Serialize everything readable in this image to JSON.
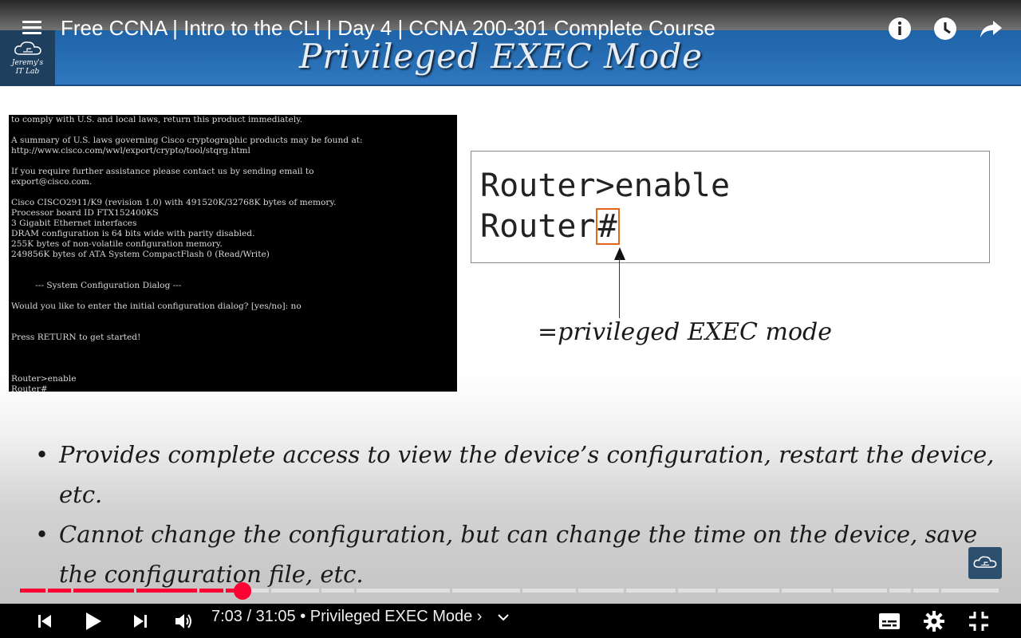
{
  "video": {
    "title": "Free CCNA | Intro to the CLI | Day 4 | CCNA 200-301 Complete Course",
    "current_time": "7:03",
    "duration": "31:05",
    "chapter": "Privileged EXEC Mode",
    "progress_fraction": 0.227
  },
  "top_icons": [
    "info-icon",
    "watch-later-icon",
    "share-icon"
  ],
  "slide": {
    "logo_text": [
      "Jeremy's",
      "IT Lab"
    ],
    "title": "Privileged EXEC Mode",
    "terminal_lines": [
      "to comply with U.S. and local laws, return this product immediately.",
      "",
      "A summary of U.S. laws governing Cisco cryptographic products may be found at:",
      "http://www.cisco.com/wwl/export/crypto/tool/stqrg.html",
      "",
      "If you require further assistance please contact us by sending email to",
      "export@cisco.com.",
      "",
      "Cisco CISCO2911/K9 (revision 1.0) with 491520K/32768K bytes of memory.",
      "Processor board ID FTX152400KS",
      "3 Gigabit Ethernet interfaces",
      "DRAM configuration is 64 bits wide with parity disabled.",
      "255K bytes of non-volatile configuration memory.",
      "249856K bytes of ATA System CompactFlash 0 (Read/Write)",
      "",
      "",
      "         --- System Configuration Dialog ---",
      "",
      "Would you like to enter the initial configuration dialog? [yes/no]: no",
      "",
      "",
      "Press RETURN to get started!",
      "",
      "",
      "",
      "Router>enable",
      "Router#"
    ],
    "router_line1": "Router>enable",
    "router_prompt": "Router",
    "router_hash": "#",
    "annotation": "=privileged EXEC mode",
    "bullets": [
      "Provides complete access to view the device’s configuration, restart the device, etc.",
      "Cannot change the configuration, but can change the time on the device, save the configuration file, etc."
    ]
  },
  "controls": {
    "buttons": [
      "previous-icon",
      "play-icon",
      "next-icon",
      "volume-icon"
    ],
    "right_buttons": [
      "subtitles-icon",
      "settings-icon",
      "exit-fullscreen-icon"
    ]
  },
  "colors": {
    "accent": "#ff0033",
    "header_blue": "#2f78bf",
    "highlight_orange": "#e2671b"
  }
}
